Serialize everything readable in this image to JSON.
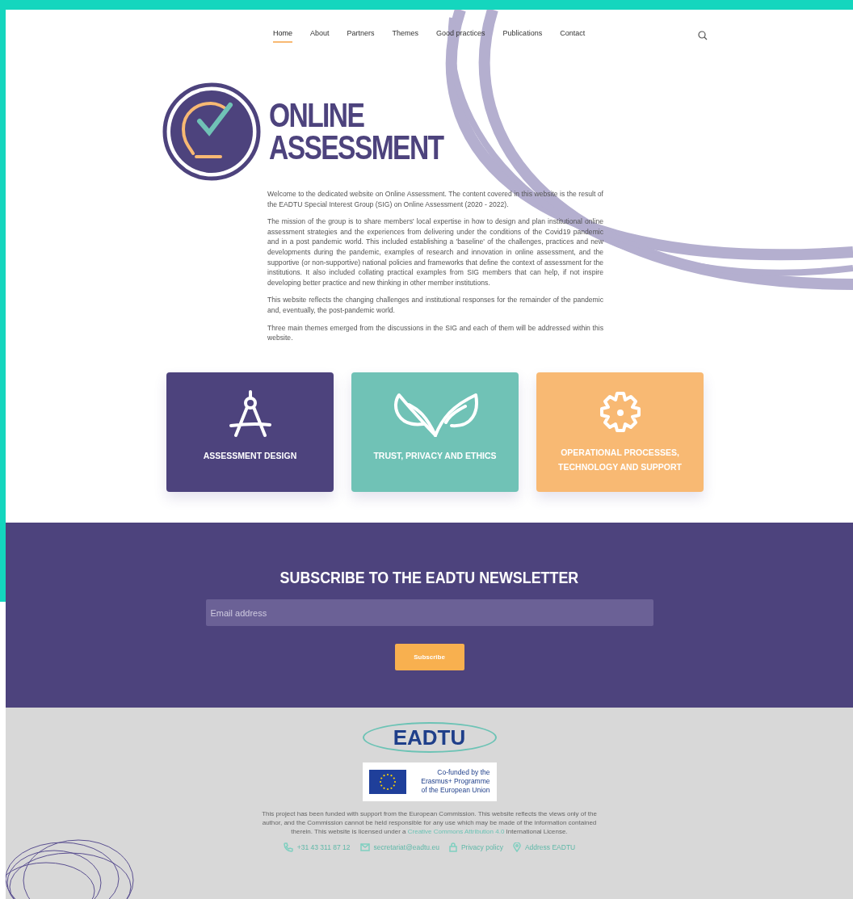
{
  "nav": {
    "items": [
      {
        "label": "Home",
        "selected": true
      },
      {
        "label": "About",
        "selected": false
      },
      {
        "label": "Partners",
        "selected": false
      },
      {
        "label": "Themes",
        "selected": false
      },
      {
        "label": "Good practices",
        "selected": false
      },
      {
        "label": "Publications",
        "selected": false
      },
      {
        "label": "Contact",
        "selected": false
      }
    ]
  },
  "logo": {
    "lines": [
      "ONLINE",
      "ASSESSMENT"
    ]
  },
  "intro": {
    "paragraphs": [
      "Welcome to the dedicated website on Online Assessment. The content covered in this website is the result of the EADTU Special Interest Group (SIG) on Online Assessment (2020 - 2022).",
      "The mission of the group is to share members' local expertise in how to design and plan institutional online assessment strategies and the experiences from delivering under the conditions of the Covid19 pandemic and in a post pandemic world. This included establishing a 'baseline' of the challenges, practices and new developments during the pandemic, examples of research and innovation in online assessment, and the supportive (or non-supportive) national policies and frameworks that define the context of assessment for the institutions. It also included collating practical examples from SIG members that can help, if not inspire developing better practice and new thinking in other member institutions.",
      "This website reflects the changing challenges and institutional responses for the remainder of the pandemic and, eventually, the post-pandemic world.",
      "Three main themes emerged from the discussions in the SIG and each of them will be addressed within this website."
    ]
  },
  "themes": [
    {
      "kind": "compass",
      "label": "ASSESSMENT DESIGN",
      "color": "#4d437d"
    },
    {
      "kind": "leaves",
      "label": "TRUST, PRIVACY AND ETHICS",
      "color": "#70c2b6"
    },
    {
      "kind": "gear",
      "label": "OPERATIONAL PROCESSES, TECHNOLOGY AND SUPPORT",
      "color": "#f8b973"
    }
  ],
  "newsletter": {
    "title": "SUBSCRIBE TO THE EADTU NEWSLETTER",
    "placeholder": "Email address",
    "button": "Subscribe"
  },
  "footer": {
    "logo": "EADTU",
    "erasmus": [
      "Co-funded by the",
      "Erasmus+ Programme",
      "of the European Union"
    ],
    "disclaimer": {
      "before": "This project has been funded with support from the European Commission. This website reflects the views only of the author, and the Commission cannot be held responsible for any use which may be made of the information contained therein. This website is licensed under a",
      "link": "Creative Commons Attribution 4.0",
      "after": "International License."
    },
    "contacts": [
      {
        "kind": "phone",
        "label": "+31 43 311 87 12"
      },
      {
        "kind": "mail",
        "label": "secretariat@eadtu.eu"
      },
      {
        "kind": "lock",
        "label": "Privacy policy"
      },
      {
        "kind": "pin",
        "label": "Address EADTU"
      }
    ]
  }
}
